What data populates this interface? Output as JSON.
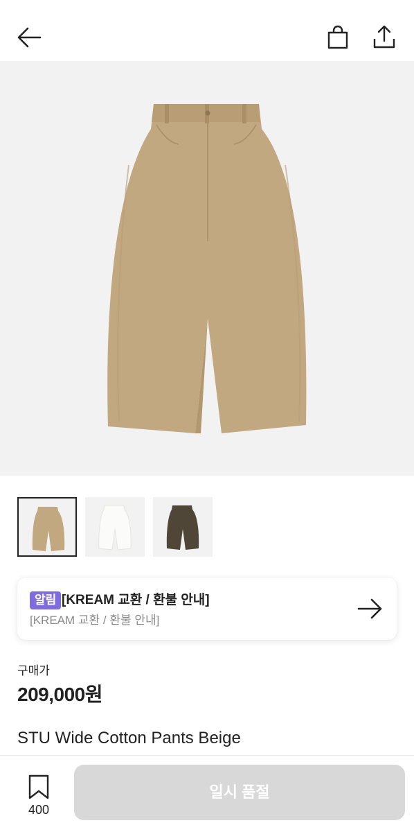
{
  "icons": {
    "back": "arrow-left-icon",
    "cart": "shopping-bag-icon",
    "share": "share-icon",
    "notice_arrow": "arrow-right-icon",
    "wishlist": "bookmark-icon"
  },
  "colors": {
    "product_beige": "#c2a881",
    "thumb_white": "#f4f3f1",
    "thumb_brown": "#4f4637",
    "badge_purple": "#7f6de0",
    "soldout_bg": "#d8d8d8"
  },
  "thumbnails": [
    {
      "label": "Beige",
      "selected": true
    },
    {
      "label": "White",
      "selected": false
    },
    {
      "label": "Brown",
      "selected": false
    }
  ],
  "notice": {
    "badge": "알림",
    "title": "[KREAM 교환 / 환불 안내]",
    "subtitle": "[KREAM 교환 / 환불 안내]"
  },
  "price": {
    "label": "구매가",
    "value": "209,000원"
  },
  "product": {
    "name": "STU Wide Cotton Pants Beige"
  },
  "bottom": {
    "wish_count": "400",
    "action_label": "일시 품절"
  }
}
